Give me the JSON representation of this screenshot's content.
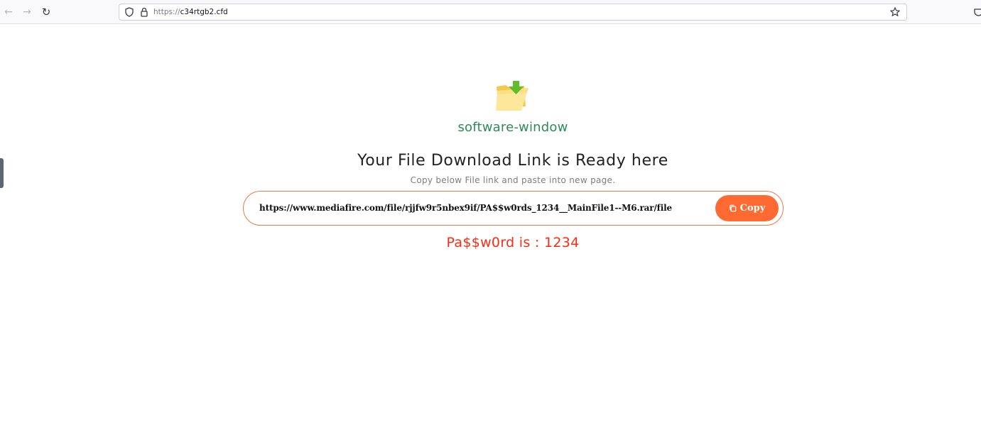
{
  "browser": {
    "url_protocol": "https://",
    "url_host": "c34rtgb2.cfd",
    "icons": [
      "back-arrow-icon",
      "forward-arrow-icon",
      "reload-icon",
      "shield-icon",
      "lock-icon",
      "bookmark-star-icon"
    ]
  },
  "page": {
    "site_name": "software-window",
    "headline": "Your File Download Link is Ready here",
    "subtext": "Copy below File link and paste into new page.",
    "download_link": "https://www.mediafire.com/file/rjjfw9r5nbex9if/PA$$w0rds_1234__MainFile1--M6.rar/file",
    "copy_label": "Copy",
    "password_text": "Pa$$w0rd is : 1234"
  },
  "colors": {
    "site_name": "#2e8b57",
    "accent": "#ff6a32",
    "password": "#ff2a12"
  }
}
